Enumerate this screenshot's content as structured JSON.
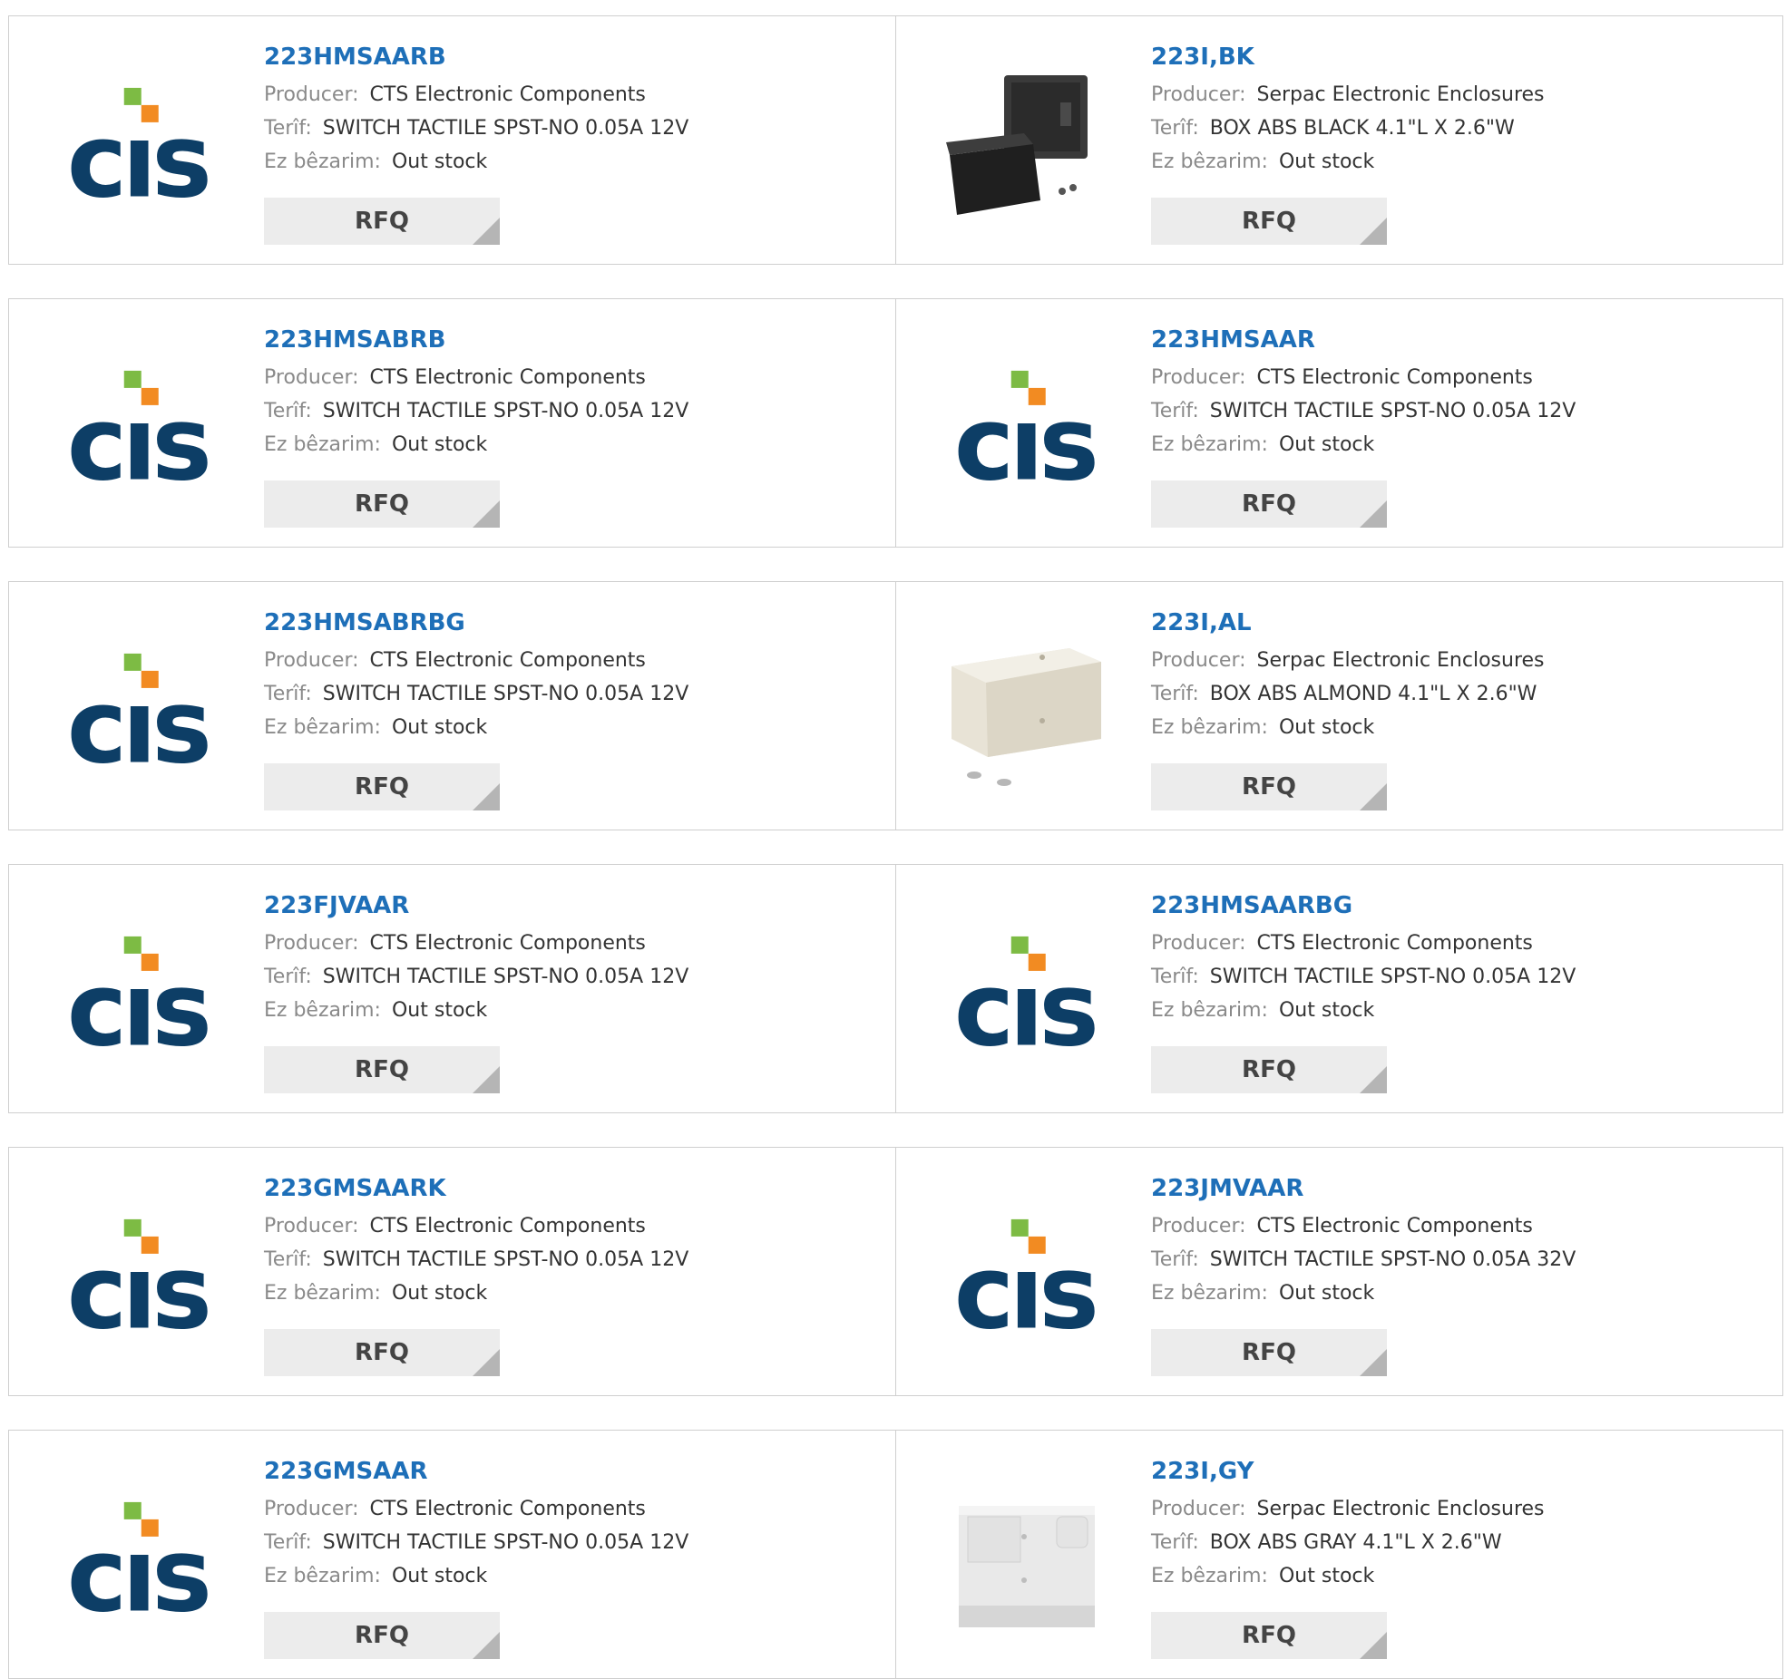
{
  "labels": {
    "producer": "Producer:",
    "description": "Terîf:",
    "stock": "Ez bêzarim:"
  },
  "rfq_label": "RFQ",
  "colors": {
    "part_number": "#1e6fb8",
    "cts_blue": "#0d3e66",
    "cts_green": "#7dbb44",
    "cts_orange": "#f28b22"
  },
  "products": [
    {
      "part_number": "223HMSAARB",
      "producer": "CTS Electronic Components",
      "description": "SWITCH TACTILE SPST-NO 0.05A 12V",
      "stock": "Out stock",
      "image": "cts-logo"
    },
    {
      "part_number": "223I,BK",
      "producer": "Serpac Electronic Enclosures",
      "description": "BOX ABS BLACK 4.1\"L X 2.6\"W",
      "stock": "Out stock",
      "image": "black-box-photo"
    },
    {
      "part_number": "223HMSABRB",
      "producer": "CTS Electronic Components",
      "description": "SWITCH TACTILE SPST-NO 0.05A 12V",
      "stock": "Out stock",
      "image": "cts-logo"
    },
    {
      "part_number": "223HMSAAR",
      "producer": "CTS Electronic Components",
      "description": "SWITCH TACTILE SPST-NO 0.05A 12V",
      "stock": "Out stock",
      "image": "cts-logo"
    },
    {
      "part_number": "223HMSABRBG",
      "producer": "CTS Electronic Components",
      "description": "SWITCH TACTILE SPST-NO 0.05A 12V",
      "stock": "Out stock",
      "image": "cts-logo"
    },
    {
      "part_number": "223I,AL",
      "producer": "Serpac Electronic Enclosures",
      "description": "BOX ABS ALMOND 4.1\"L X 2.6\"W",
      "stock": "Out stock",
      "image": "almond-box-photo"
    },
    {
      "part_number": "223FJVAAR",
      "producer": "CTS Electronic Components",
      "description": "SWITCH TACTILE SPST-NO 0.05A 12V",
      "stock": "Out stock",
      "image": "cts-logo"
    },
    {
      "part_number": "223HMSAARBG",
      "producer": "CTS Electronic Components",
      "description": "SWITCH TACTILE SPST-NO 0.05A 12V",
      "stock": "Out stock",
      "image": "cts-logo"
    },
    {
      "part_number": "223GMSAARK",
      "producer": "CTS Electronic Components",
      "description": "SWITCH TACTILE SPST-NO 0.05A 12V",
      "stock": "Out stock",
      "image": "cts-logo"
    },
    {
      "part_number": "223JMVAAR",
      "producer": "CTS Electronic Components",
      "description": "SWITCH TACTILE SPST-NO 0.05A 32V",
      "stock": "Out stock",
      "image": "cts-logo"
    },
    {
      "part_number": "223GMSAAR",
      "producer": "CTS Electronic Components",
      "description": "SWITCH TACTILE SPST-NO 0.05A 12V",
      "stock": "Out stock",
      "image": "cts-logo"
    },
    {
      "part_number": "223I,GY",
      "producer": "Serpac Electronic Enclosures",
      "description": "BOX ABS GRAY 4.1\"L X 2.6\"W",
      "stock": "Out stock",
      "image": "gray-box-photo"
    }
  ]
}
